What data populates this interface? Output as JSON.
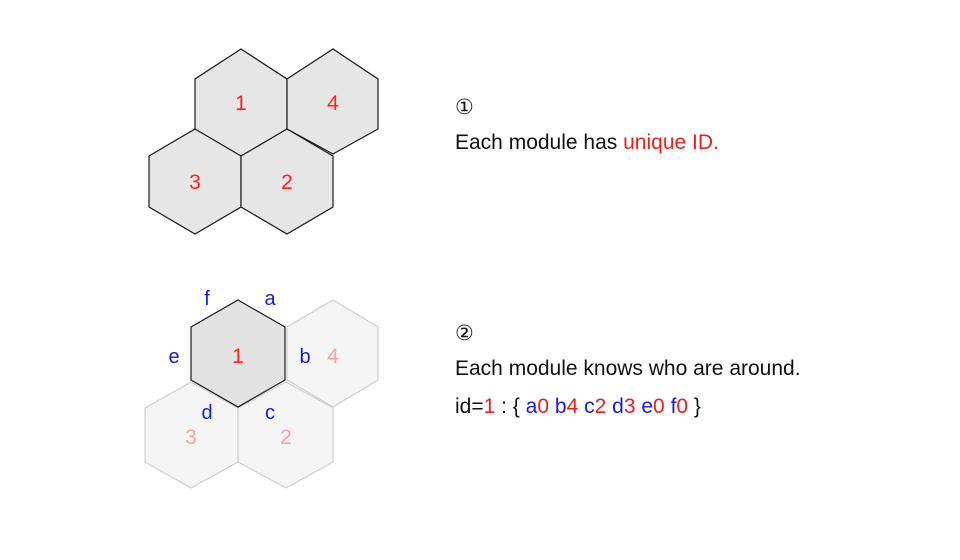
{
  "section1": {
    "step": "①",
    "text_prefix": "Each module has ",
    "text_highlight": "unique ID.",
    "modules": [
      "1",
      "4",
      "3",
      "2"
    ]
  },
  "section2": {
    "step": "②",
    "text": "Each module knows who are around.",
    "center_id": "1",
    "side_labels": [
      "a",
      "b",
      "c",
      "d",
      "e",
      "f"
    ],
    "neighbors": [
      "4",
      "2",
      "3"
    ],
    "code_prefix": "id=",
    "code_id": "1",
    "code_sep": " :  { ",
    "code_entries": [
      {
        "side": "a",
        "value": "0"
      },
      {
        "side": "b",
        "value": "4"
      },
      {
        "side": "c",
        "value": "2"
      },
      {
        "side": "d",
        "value": "3"
      },
      {
        "side": "e",
        "value": "0"
      },
      {
        "side": "f",
        "value": "0"
      }
    ],
    "code_close": " }"
  },
  "colors": {
    "id_red": "#ee1c1c",
    "side_blue": "#1a1adb",
    "hex_fill": "#e6e6e6",
    "hex_faded_fill": "#f5f5f5"
  }
}
